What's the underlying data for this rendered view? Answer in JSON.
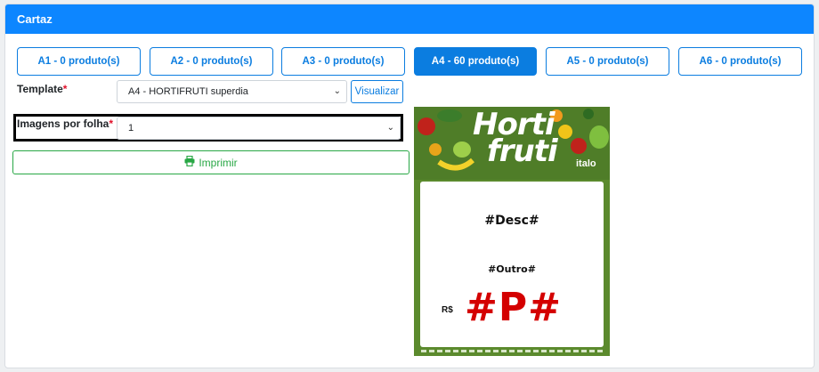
{
  "header": {
    "title": "Cartaz"
  },
  "tabs": [
    {
      "label": "A1 - 0 produto(s)",
      "active": false
    },
    {
      "label": "A2 - 0 produto(s)",
      "active": false
    },
    {
      "label": "A3 - 0 produto(s)",
      "active": false
    },
    {
      "label": "A4 - 60 produto(s)",
      "active": true
    },
    {
      "label": "A5 - 0 produto(s)",
      "active": false
    },
    {
      "label": "A6 - 0 produto(s)",
      "active": false
    }
  ],
  "form": {
    "template_label": "Template",
    "template_value": "A4 - HORTIFRUTI superdia",
    "view_button": "Visualizar",
    "images_label": "Imagens por folha",
    "images_value": "1",
    "required_mark": "*",
    "print_button": "Imprimir"
  },
  "preview": {
    "logo_line1": "Horti",
    "logo_line2": "fruti",
    "brand": "italo",
    "desc_placeholder": "#Desc#",
    "other_placeholder": "#Outro#",
    "currency": "R$",
    "price_placeholder": "#P#"
  },
  "colors": {
    "primary": "#0d86ff",
    "success": "#28a745",
    "required": "#e0102a",
    "price": "#d40000",
    "poster_green": "#5b8a2d"
  },
  "icons": {
    "print": "printer-icon",
    "dropdown": "chevron-down-icon"
  }
}
